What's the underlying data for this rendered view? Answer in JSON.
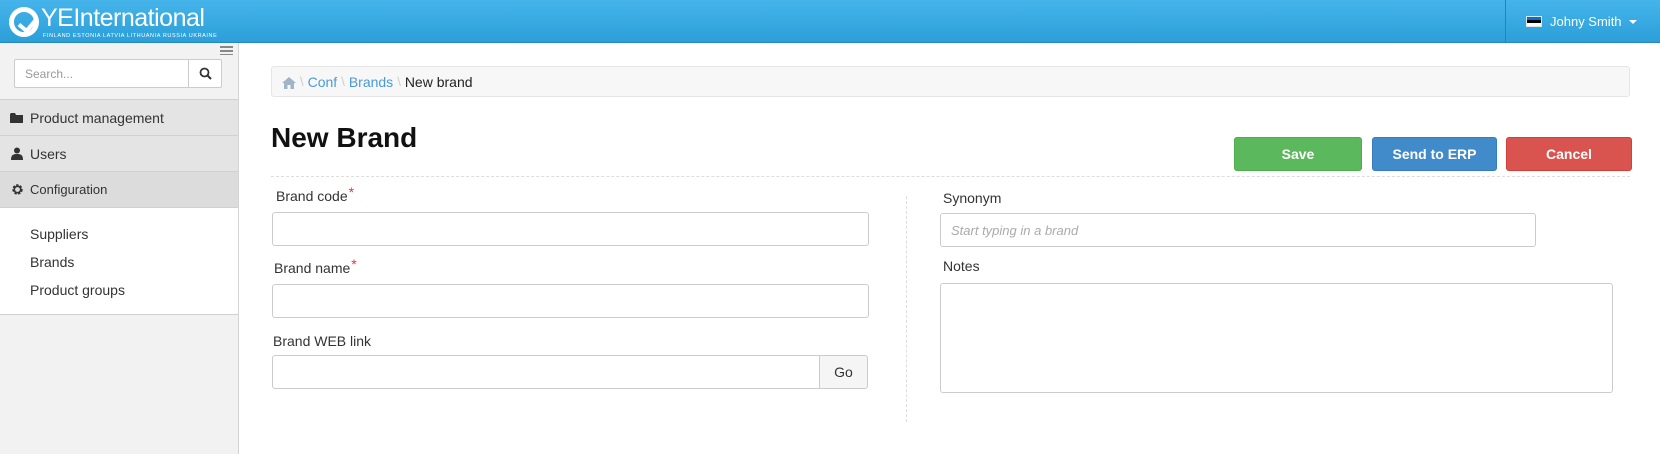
{
  "header": {
    "logo_text": "YEInternational",
    "logo_tagline": "FINLAND  ESTONIA  LATVIA  LITHUANIA  RUSSIA  UKRAINE",
    "user_name": "Johny Smith",
    "flag_colors": [
      "#0072ce",
      "#000000",
      "#ffffff"
    ]
  },
  "sidebar": {
    "search_placeholder": "Search...",
    "menu": [
      {
        "label": "Product management",
        "icon": "folder-icon"
      },
      {
        "label": "Users",
        "icon": "user-icon"
      },
      {
        "label": "Configuration",
        "icon": "gear-icon"
      }
    ],
    "submenu": [
      "Suppliers",
      "Brands",
      "Product groups"
    ]
  },
  "breadcrumb": {
    "items": [
      "Conf",
      "Brands"
    ],
    "current": "New brand"
  },
  "page": {
    "title": "New Brand",
    "buttons": {
      "save": "Save",
      "send_to_erp": "Send to ERP",
      "cancel": "Cancel"
    },
    "form": {
      "brand_code_label": "Brand code",
      "brand_name_label": "Brand name",
      "brand_web_link_label": "Brand WEB link",
      "go_label": "Go",
      "synonym_label": "Synonym",
      "synonym_placeholder": "Start typing in a brand",
      "notes_label": "Notes",
      "required_mark": "*"
    }
  },
  "colors": {
    "topbar": "#2c9fd9",
    "save": "#5cb85c",
    "erp": "#428bca",
    "cancel": "#d9534f",
    "link": "#4a9bd8"
  }
}
